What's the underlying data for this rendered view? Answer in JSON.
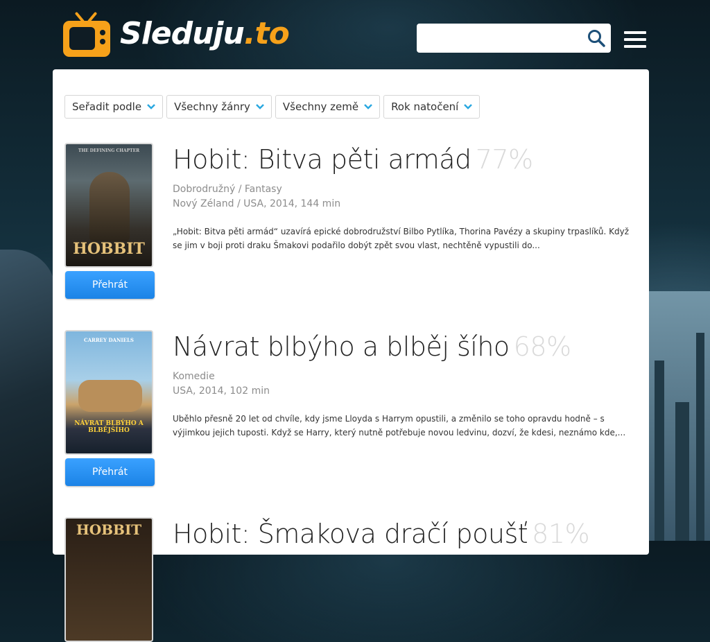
{
  "brand": {
    "name": "Sleduju",
    "dot_suffix": ".to",
    "accent": "#f6a11a"
  },
  "search": {
    "placeholder": "",
    "value": ""
  },
  "filters": [
    {
      "label": "Seřadit podle"
    },
    {
      "label": "Všechny žánry"
    },
    {
      "label": "Všechny země"
    },
    {
      "label": "Rok natočení"
    }
  ],
  "movies": [
    {
      "title": "Hobit: Bitva pěti armád",
      "rating": "77%",
      "genre": "Dobrodružný / Fantasy",
      "info": "Nový Zéland / USA, 2014, 144 min",
      "description": "„Hobit: Bitva pěti armád“ uzavírá epické dobrodružství Bilbo Pytlíka, Thorina Pavézy a skupiny trpaslíků. Když se jim v boji proti draku Šmakovi podařilo dobýt zpět svou vlast, nechtěně vypustili do...",
      "poster_text": "HOBBIT",
      "poster_tagline": "THE DEFINING CHAPTER",
      "play_label": "Přehrát"
    },
    {
      "title": "Návrat blbýho a blběj šího",
      "rating": "68%",
      "genre": "Komedie",
      "info": "USA, 2014, 102 min",
      "description": "Uběhlo přesně 20 let od chvíle, kdy jsme Lloyda s Harrym opustili, a změnilo se toho opravdu hodně – s výjimkou jejich tuposti. Když se Harry, který nutně potřebuje novou ledvinu, dozví, že kdesi, neznámo kde,...",
      "poster_text": "NÁVRAT BLBÝHO A BLBĚJŠÍHO",
      "poster_tagline": "CARREY   DANIELS",
      "play_label": "Přehrát"
    },
    {
      "title": "Hobit: Šmakova dračí poušť",
      "rating": "81%",
      "poster_text": "HOBBIT"
    }
  ]
}
